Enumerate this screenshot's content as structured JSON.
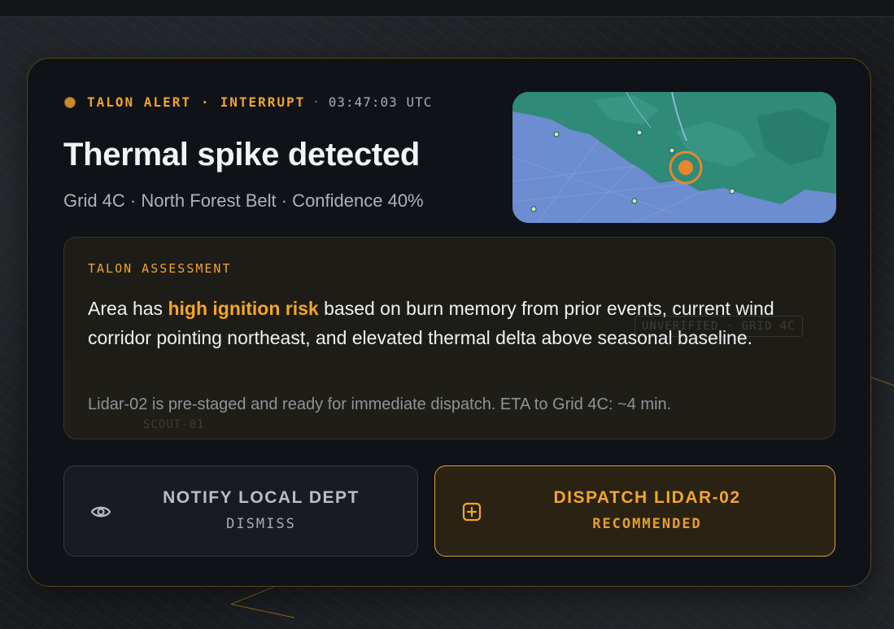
{
  "alert": {
    "source": "TALON ALERT",
    "separator": "·",
    "type": "INTERRUPT",
    "time": "03:47:03 UTC",
    "title": "Thermal spike detected",
    "subtitle": "Grid 4C · North Forest Belt · Confidence 40%"
  },
  "assessment": {
    "label": "TALON ASSESSMENT",
    "body_prefix": "Area has ",
    "body_highlight": "high ignition risk",
    "body_suffix": " based on burn memory from prior events, current wind corridor pointing northeast, and elevated thermal delta above seasonal baseline.",
    "note": "Lidar-02 is pre-staged and ready for immediate dispatch. ETA to Grid 4C: ~4 min."
  },
  "actions": {
    "notify": {
      "label": "NOTIFY LOCAL DEPT",
      "sub": "DISMISS",
      "icon": "eye-icon"
    },
    "dispatch": {
      "label": "DISPATCH LIDAR-02",
      "sub": "RECOMMENDED",
      "icon": "plus-square-icon"
    }
  },
  "background": {
    "ghost_label_1": "UNVERIFIED · GRID 4C",
    "ghost_label_2": "SCOUT-01"
  },
  "colors": {
    "accent": "#f0a429",
    "card_bg": "#0f1216",
    "map_land": "#6b8ccf",
    "map_forest": "#2f8a78",
    "target": "#e8872a"
  }
}
